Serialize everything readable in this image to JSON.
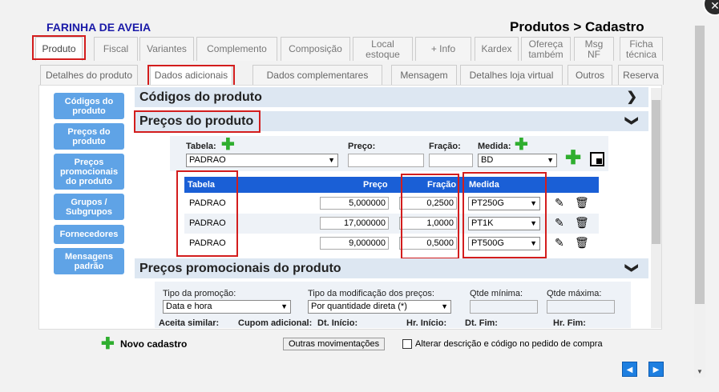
{
  "app": {
    "brand": "FARINHA DE AVEIA",
    "title": "Produtos > Cadastro",
    "close_icon": "close-icon"
  },
  "tabs_main": [
    {
      "label": "Produto"
    },
    {
      "label": "Fiscal"
    },
    {
      "label": "Variantes"
    },
    {
      "label": "Complemento"
    },
    {
      "label": "Composição"
    },
    {
      "label": "Local estoque"
    },
    {
      "label": "+ Info"
    },
    {
      "label": "Kardex"
    },
    {
      "label": "Ofereça também"
    },
    {
      "label": "Msg NF"
    },
    {
      "label": "Ficha técnica"
    }
  ],
  "tabs_sub": [
    {
      "label": "Detalhes do produto"
    },
    {
      "label": "Dados adicionais"
    },
    {
      "label": "Dados complementares"
    },
    {
      "label": "Mensagem"
    },
    {
      "label": "Detalhes loja virtual"
    },
    {
      "label": "Outros"
    },
    {
      "label": "Reserva"
    }
  ],
  "sidebar": [
    {
      "label": "Códigos do produto"
    },
    {
      "label": "Preços do produto"
    },
    {
      "label": "Preços promocionais do produto"
    },
    {
      "label": "Grupos / Subgrupos"
    },
    {
      "label": "Fornecedores"
    },
    {
      "label": "Mensagens padrão"
    }
  ],
  "sections": {
    "codigos": "Códigos do produto",
    "precos": "Preços do produto",
    "promo": "Preços promocionais do produto"
  },
  "precos_form": {
    "tabela_label": "Tabela:",
    "tabela_value": "PADRAO",
    "preco_label": "Preço:",
    "preco_value": "",
    "fracao_label": "Fração:",
    "fracao_value": "",
    "medida_label": "Medida:",
    "medida_value": "BD"
  },
  "precos_table": {
    "headers": {
      "tabela": "Tabela",
      "preco": "Preço",
      "fracao": "Fração",
      "medida": "Medida"
    },
    "rows": [
      {
        "tabela": "PADRAO",
        "preco": "5,000000",
        "fracao": "0,2500",
        "medida": "PT250G"
      },
      {
        "tabela": "PADRAO",
        "preco": "17,000000",
        "fracao": "1,0000",
        "medida": "PT1K"
      },
      {
        "tabela": "PADRAO",
        "preco": "9,000000",
        "fracao": "0,5000",
        "medida": "PT500G"
      }
    ]
  },
  "promo_form": {
    "tipo_label": "Tipo da promoção:",
    "tipo_value": "Data e hora",
    "mod_label": "Tipo da modificação dos preços:",
    "mod_value": "Por quantidade direta (*)",
    "qmin_label": "Qtde mínima:",
    "qmax_label": "Qtde máxima:",
    "aceita_label": "Aceita similar:",
    "cupom_label": "Cupom adicional:",
    "dt_ini_label": "Dt. Início:",
    "hr_ini_label": "Hr. Início:",
    "dt_fim_label": "Dt. Fim:",
    "hr_fim_label": "Hr. Fim:"
  },
  "footer": {
    "novo": "Novo cadastro",
    "outras": "Outras movimentações",
    "alterar": "Alterar descrição e código no pedido de compra"
  },
  "colors": {
    "accent": "#1a5fd6",
    "sidebar": "#5fa3e6",
    "highlight": "#d31d1d",
    "section": "#dde7f2"
  }
}
